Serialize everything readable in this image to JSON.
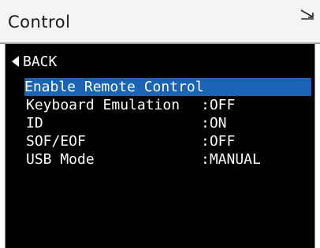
{
  "header": {
    "title": "Control",
    "status_icon": "signal-arrow-icon"
  },
  "menu": {
    "back_label": "BACK",
    "back_icon": "triangle-left-icon",
    "items": [
      {
        "label": "Enable Remote Control",
        "value": "",
        "selected": true
      },
      {
        "label": "Keyboard Emulation",
        "value": ":OFF",
        "selected": false
      },
      {
        "label": "ID",
        "value": ":ON",
        "selected": false
      },
      {
        "label": "SOF/EOF",
        "value": ":OFF",
        "selected": false
      },
      {
        "label": "USB Mode",
        "value": ":MANUAL",
        "selected": false
      }
    ]
  },
  "colors": {
    "selection": "#1b63b4",
    "screen_bg": "#000000",
    "text": "#ffffff"
  }
}
